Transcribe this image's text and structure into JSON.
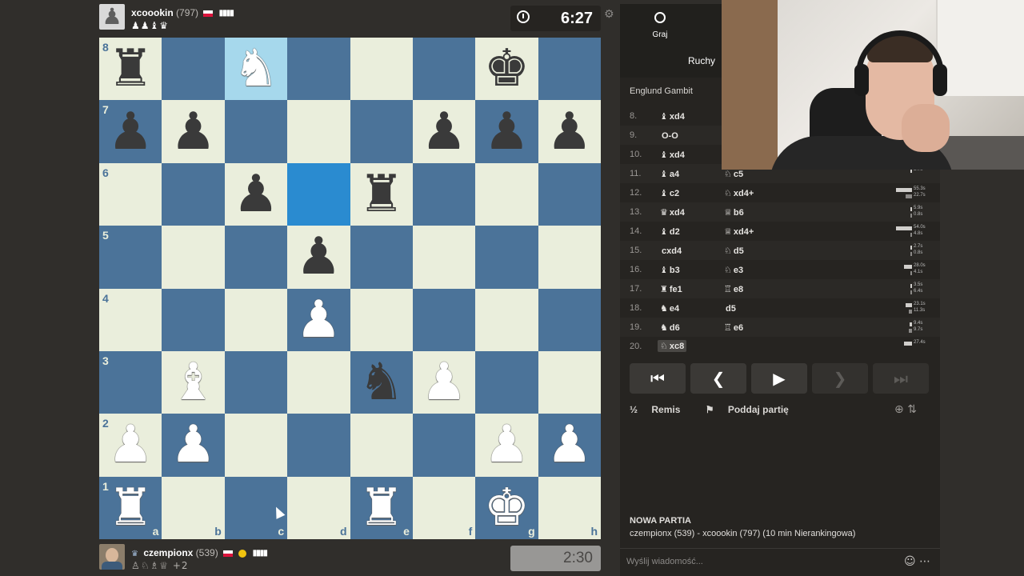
{
  "top_player": {
    "name": "xcoookin",
    "rating": "(797)",
    "captured": "♟♟♝♛",
    "clock": "6:27"
  },
  "bottom_player": {
    "name": "czempionx",
    "rating": "(539)",
    "captured": "♙♘♗♕",
    "captured_extra": "+2",
    "clock": "2:30"
  },
  "board": {
    "ranks": [
      "8",
      "7",
      "6",
      "5",
      "4",
      "3",
      "2",
      "1"
    ],
    "files": [
      "a",
      "b",
      "c",
      "d",
      "e",
      "f",
      "g",
      "h"
    ],
    "position": [
      [
        "bR",
        "",
        "wN",
        "",
        "",
        "",
        "bK",
        ""
      ],
      [
        "bP",
        "bP",
        "",
        "",
        "",
        "bP",
        "bP",
        "bP"
      ],
      [
        "",
        "",
        "bP",
        "",
        "bR",
        "",
        "",
        ""
      ],
      [
        "",
        "",
        "",
        "bP",
        "",
        "",
        "",
        ""
      ],
      [
        "",
        "",
        "",
        "wP",
        "",
        "",
        "",
        ""
      ],
      [
        "",
        "wB",
        "",
        "",
        "bN",
        "wP",
        "",
        ""
      ],
      [
        "wP",
        "wP",
        "",
        "",
        "",
        "",
        "wP",
        "wP"
      ],
      [
        "wR",
        "",
        "",
        "",
        "wR",
        "",
        "wK",
        ""
      ]
    ],
    "highlights": [
      "c8",
      "d6"
    ]
  },
  "panel": {
    "tab_play": "Graj",
    "tab_moves": "Ruchy",
    "opening": "Englund Gambit",
    "moves": [
      {
        "num": "8.",
        "white_piece": "♝",
        "white": "xd4",
        "black_piece": "",
        "black": ""
      },
      {
        "num": "9.",
        "white_piece": "",
        "white": "O-O",
        "black_piece": "",
        "black": ""
      },
      {
        "num": "10.",
        "white_piece": "♝",
        "white": "xd4",
        "black_piece": "",
        "black": ""
      },
      {
        "num": "11.",
        "white_piece": "♝",
        "white": "a4",
        "black_piece": "♘",
        "black": "c5"
      },
      {
        "num": "12.",
        "white_piece": "♝",
        "white": "c2",
        "black_piece": "♘",
        "black": "xd4+"
      },
      {
        "num": "13.",
        "white_piece": "♛",
        "white": "xd4",
        "black_piece": "♕",
        "black": "b6"
      },
      {
        "num": "14.",
        "white_piece": "♝",
        "white": "d2",
        "black_piece": "♕",
        "black": "xd4+"
      },
      {
        "num": "15.",
        "white_piece": "",
        "white": "cxd4",
        "black_piece": "♘",
        "black": "d5"
      },
      {
        "num": "16.",
        "white_piece": "♝",
        "white": "b3",
        "black_piece": "♘",
        "black": "e3"
      },
      {
        "num": "17.",
        "white_piece": "♜",
        "white": "fe1",
        "black_piece": "♖",
        "black": "e8"
      },
      {
        "num": "18.",
        "white_piece": "♞",
        "white": "e4",
        "black_piece": "",
        "black": "d5"
      },
      {
        "num": "19.",
        "white_piece": "♞",
        "white": "d6",
        "black_piece": "♖",
        "black": "e6"
      },
      {
        "num": "20.",
        "white_piece": "♘",
        "white": "xc8",
        "black_piece": "",
        "black": ""
      }
    ],
    "move_times": [
      {
        "row": 3,
        "t1": "5.7s",
        "t2": "",
        "w1": 0.1,
        "w2": 0
      },
      {
        "row": 4,
        "t1": "55.3s",
        "t2": "22.7s",
        "w1": 1.0,
        "w2": 0.4
      },
      {
        "row": 5,
        "t1": "5.9s",
        "t2": "0.8s",
        "w1": 0.1,
        "w2": 0.02
      },
      {
        "row": 6,
        "t1": "54.0s",
        "t2": "4.8s",
        "w1": 0.98,
        "w2": 0.09
      },
      {
        "row": 7,
        "t1": "2.7s",
        "t2": "0.8s",
        "w1": 0.05,
        "w2": 0.02
      },
      {
        "row": 8,
        "t1": "28.0s",
        "t2": "4.1s",
        "w1": 0.5,
        "w2": 0.07
      },
      {
        "row": 9,
        "t1": "3.5s",
        "t2": "6.4s",
        "w1": 0.06,
        "w2": 0.12
      },
      {
        "row": 10,
        "t1": "23.1s",
        "t2": "11.3s",
        "w1": 0.42,
        "w2": 0.2
      },
      {
        "row": 11,
        "t1": "9.4s",
        "t2": "9.7s",
        "w1": 0.17,
        "w2": 0.18
      },
      {
        "row": 12,
        "t1": "27.4s",
        "t2": "",
        "w1": 0.5,
        "w2": 0
      }
    ],
    "nav": {
      "first": "⏮",
      "prev": "❮",
      "play": "▶",
      "next": "❯",
      "last": "⏭"
    },
    "draw_label": "Remis",
    "draw_icon": "½",
    "resign_label": "Poddaj partię",
    "resign_icon": "⚑",
    "game_title": "NOWA PARTIA",
    "game_desc": "czempionx (539) - xcoookin (797) (10 min Nierankingowa)",
    "chat_placeholder": "Wyślij wiadomość..."
  }
}
